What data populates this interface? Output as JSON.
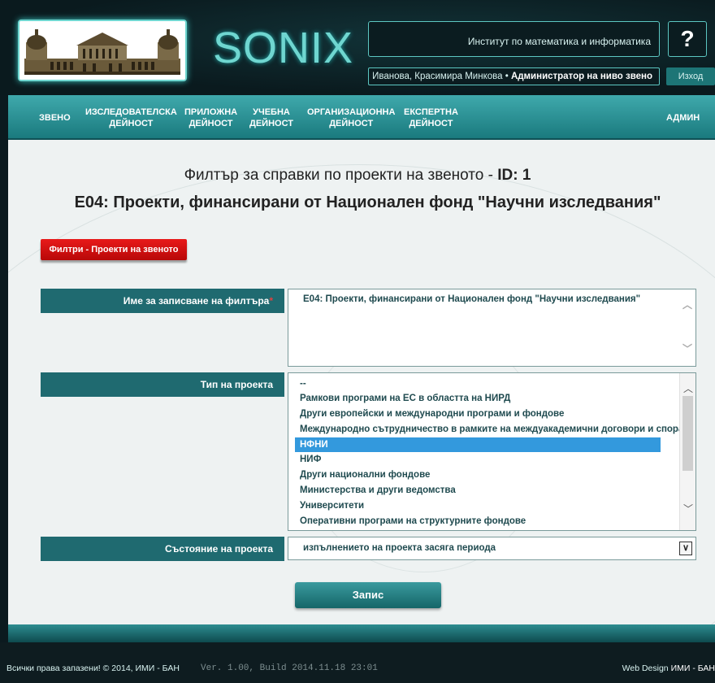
{
  "header": {
    "app_name": "SONIX",
    "institute": "Институт по математика и информатика",
    "user_name": "Иванова, Красимира Минкова",
    "user_sep": " • ",
    "user_role": "Администратор на ниво звено",
    "help_label": "?",
    "logout_label": "Изход"
  },
  "nav": {
    "items": [
      {
        "line1": "ЗВЕНО",
        "line2": ""
      },
      {
        "line1": "ИЗСЛЕДОВАТЕЛСКА",
        "line2": "ДЕЙНОСТ"
      },
      {
        "line1": "ПРИЛОЖНА",
        "line2": "ДЕЙНОСТ"
      },
      {
        "line1": "УЧЕБНА",
        "line2": "ДЕЙНОСТ"
      },
      {
        "line1": "ОРГАНИЗАЦИОННА",
        "line2": "ДЕЙНОСТ"
      },
      {
        "line1": "ЕКСПЕРТНА",
        "line2": "ДЕЙНОСТ"
      }
    ],
    "admin": "АДМИН"
  },
  "page": {
    "title_prefix": "Филтър за справки по проекти на звеното - ",
    "title_id": "ID: 1",
    "subtitle": "Е04: Проекти, финансирани от Национален фонд \"Научни изследвания\"",
    "filter_button": "Филтри - Проекти на звеното"
  },
  "form": {
    "filter_name_label": "Име за записване на филтъра",
    "required_mark": "*",
    "filter_name_value": "Е04: Проекти, финансирани от Национален фонд \"Научни изследвания\"",
    "project_type_label": "Тип на проекта",
    "project_type_options": [
      "--",
      "Рамкови програми на ЕС в областта на НИРД",
      "Други европейски и международни програми и фондове",
      "Международно сътрудничество в рамките на междуакадемични договори и споразумения",
      "НФНИ",
      "НИФ",
      "Други национални фондове",
      "Министерства и други ведомства",
      "Университети",
      "Оперативни програми на структурните фондове"
    ],
    "project_type_selected": "НФНИ",
    "project_state_label": "Състояние на проекта",
    "project_state_value": "изпълнението на проекта засяга периода",
    "save_button": "Запис"
  },
  "footer": {
    "copyright": "Всички права запазени! © 2014, ИМИ - БАН",
    "build": "Ver. 1.00, Build 2014.11.18 23:01",
    "design_label": "Web Design",
    "design_owner": "ИМИ - БАН"
  }
}
